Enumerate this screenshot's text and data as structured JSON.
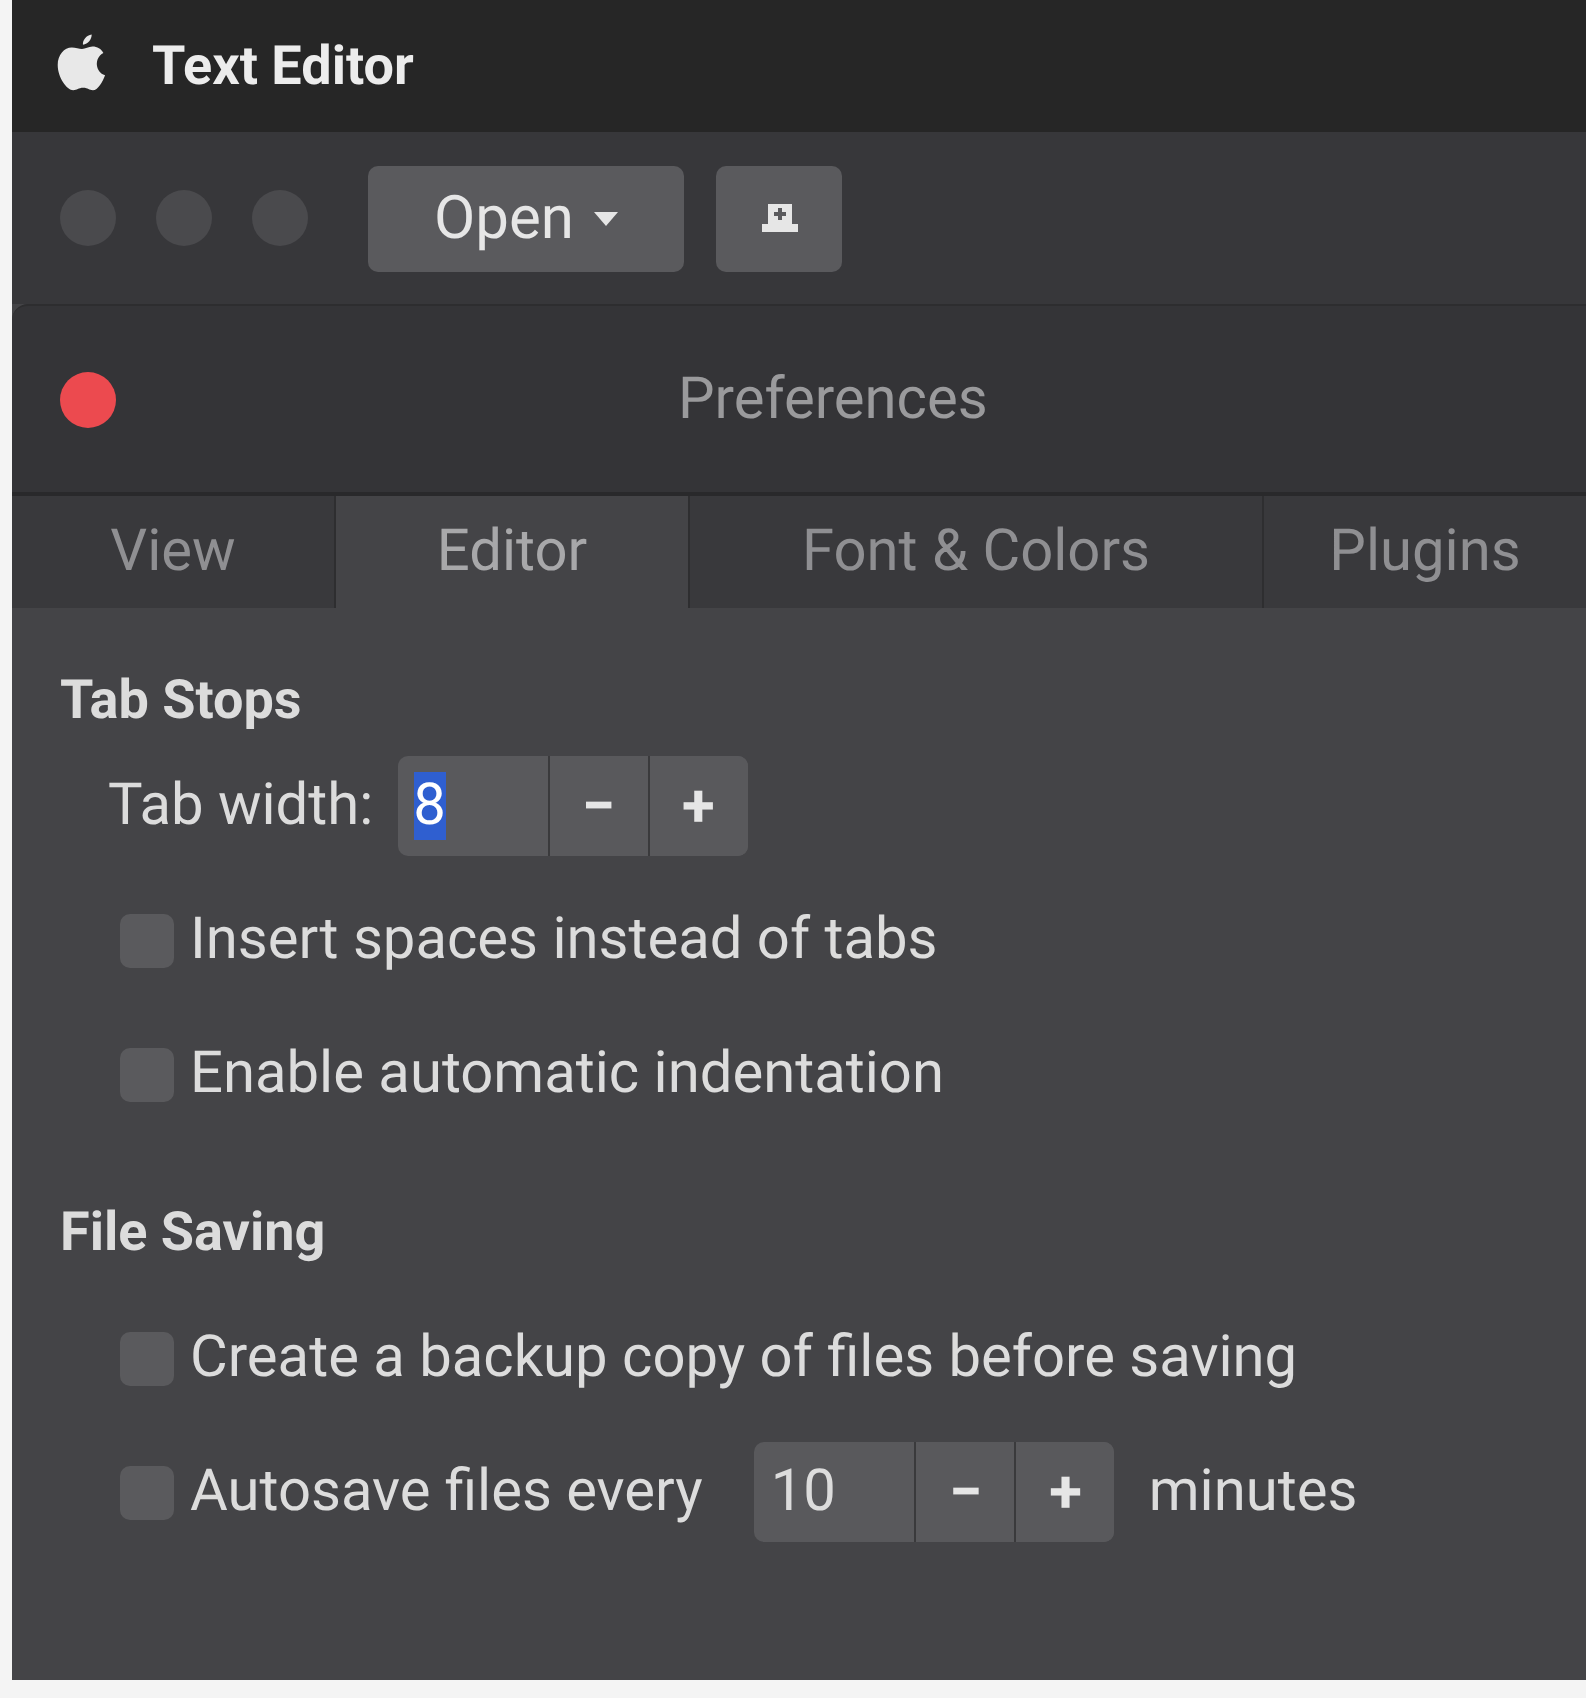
{
  "menubar": {
    "title": "Text Editor"
  },
  "toolbar": {
    "open_button": "Open"
  },
  "dialog": {
    "title": "Preferences"
  },
  "tabs": [
    {
      "label": "View",
      "selected": false
    },
    {
      "label": "Editor",
      "selected": true
    },
    {
      "label": "Font & Colors",
      "selected": false
    },
    {
      "label": "Plugins",
      "selected": false
    }
  ],
  "sections": [
    {
      "heading": "Tab Stops",
      "rows": [
        {
          "kind": "spin",
          "label": "Tab width:",
          "value": "8",
          "value_selected": true
        },
        {
          "kind": "check",
          "label": "Insert spaces instead of tabs",
          "checked": false
        },
        {
          "kind": "check",
          "label": "Enable automatic indentation",
          "checked": false
        }
      ]
    },
    {
      "heading": "File Saving",
      "rows": [
        {
          "kind": "check",
          "label": "Create a backup copy of files before saving",
          "checked": false
        },
        {
          "kind": "checkspin",
          "label": "Autosave files every",
          "checked": false,
          "value": "10",
          "value_selected": false,
          "suffix": "minutes"
        }
      ]
    }
  ],
  "spin_buttons": {
    "minus": "−",
    "plus": "+"
  }
}
